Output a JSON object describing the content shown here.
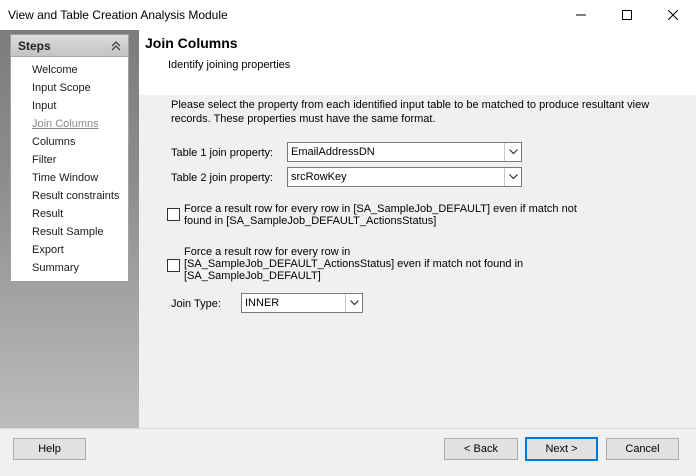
{
  "window": {
    "title": "View and Table Creation Analysis Module"
  },
  "steps": {
    "title": "Steps",
    "items": [
      {
        "label": "Welcome"
      },
      {
        "label": "Input Scope"
      },
      {
        "label": "Input"
      },
      {
        "label": "Join Columns"
      },
      {
        "label": "Columns"
      },
      {
        "label": "Filter"
      },
      {
        "label": "Time Window"
      },
      {
        "label": "Result constraints"
      },
      {
        "label": "Result"
      },
      {
        "label": "Result Sample"
      },
      {
        "label": "Export"
      },
      {
        "label": "Summary"
      }
    ],
    "current": "Join Columns"
  },
  "page": {
    "title": "Join Columns",
    "subtitle": "Identify joining properties",
    "instructions": "Please select the property from each identified input table to be matched to produce resultant view records. These properties must have the same format."
  },
  "form": {
    "table1_label": "Table 1 join property:",
    "table1_value": "EmailAddressDN",
    "table2_label": "Table 2 join property:",
    "table2_value": "srcRowKey",
    "force1_label": "Force a result row for every row in [SA_SampleJob_DEFAULT] even if match not found in [SA_SampleJob_DEFAULT_ActionsStatus]",
    "force1_checked": false,
    "force2_label": "Force a result row for every row in [SA_SampleJob_DEFAULT_ActionsStatus] even if match not found in [SA_SampleJob_DEFAULT]",
    "force2_checked": false,
    "join_type_label": "Join Type:",
    "join_type_value": "INNER"
  },
  "footer": {
    "help": "Help",
    "back": "< Back",
    "next": "Next >",
    "cancel": "Cancel"
  },
  "icons": {
    "minimize": "minimize-icon",
    "maximize": "maximize-icon",
    "close": "close-icon",
    "collapse": "double-chevron-up-icon",
    "dropdown": "chevron-down-icon"
  },
  "colors": {
    "default_button_border": "#0078d7",
    "current_step": "#8a8a8a"
  }
}
